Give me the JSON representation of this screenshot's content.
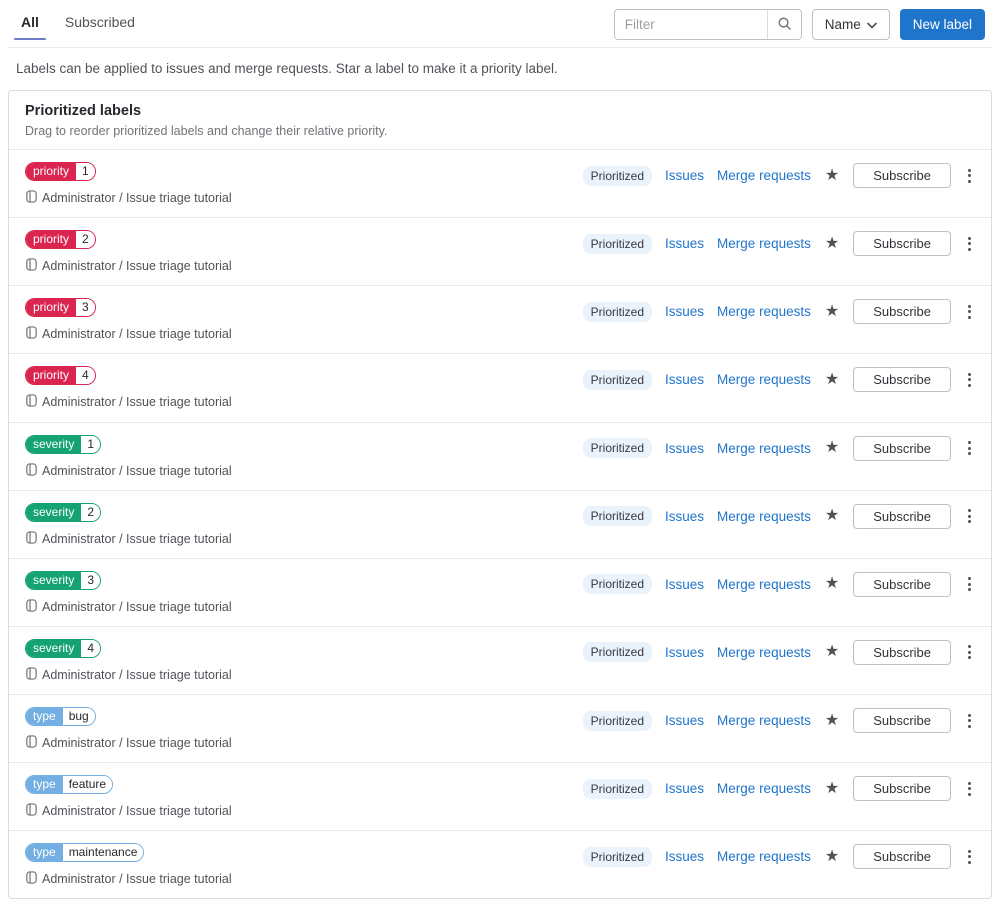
{
  "tabs": [
    {
      "label": "All",
      "active": true
    },
    {
      "label": "Subscribed",
      "active": false
    }
  ],
  "filter": {
    "placeholder": "Filter"
  },
  "sort_dropdown": {
    "label": "Name"
  },
  "new_label_button": "New label",
  "description": "Labels can be applied to issues and merge requests. Star a label to make it a priority label.",
  "card": {
    "title": "Prioritized labels",
    "subtitle": "Drag to reorder prioritized labels and change their relative priority."
  },
  "row_common": {
    "badge": "Prioritized",
    "issues_link": "Issues",
    "merge_requests_link": "Merge requests",
    "subscribe_button": "Subscribe",
    "star_icon": "star-icon",
    "kebab_icon": "kebab-menu-icon",
    "project_icon": "project-icon"
  },
  "colors": {
    "accent_blue": "#1f75cb",
    "tab_indicator": "#6e7bc4",
    "priority_red": "#d9254f",
    "severity_green": "#15a374",
    "type_blue": "#73afe3",
    "badge_bg": "#eaf2fb"
  },
  "labels": [
    {
      "scope": "priority",
      "value": "1",
      "color": "#d9254f",
      "project": "Administrator / Issue triage tutorial"
    },
    {
      "scope": "priority",
      "value": "2",
      "color": "#d9254f",
      "project": "Administrator / Issue triage tutorial"
    },
    {
      "scope": "priority",
      "value": "3",
      "color": "#d9254f",
      "project": "Administrator / Issue triage tutorial"
    },
    {
      "scope": "priority",
      "value": "4",
      "color": "#d9254f",
      "project": "Administrator / Issue triage tutorial"
    },
    {
      "scope": "severity",
      "value": "1",
      "color": "#15a374",
      "project": "Administrator / Issue triage tutorial"
    },
    {
      "scope": "severity",
      "value": "2",
      "color": "#15a374",
      "project": "Administrator / Issue triage tutorial"
    },
    {
      "scope": "severity",
      "value": "3",
      "color": "#15a374",
      "project": "Administrator / Issue triage tutorial"
    },
    {
      "scope": "severity",
      "value": "4",
      "color": "#15a374",
      "project": "Administrator / Issue triage tutorial"
    },
    {
      "scope": "type",
      "value": "bug",
      "color": "#73afe3",
      "project": "Administrator / Issue triage tutorial"
    },
    {
      "scope": "type",
      "value": "feature",
      "color": "#73afe3",
      "project": "Administrator / Issue triage tutorial"
    },
    {
      "scope": "type",
      "value": "maintenance",
      "color": "#73afe3",
      "project": "Administrator / Issue triage tutorial"
    }
  ]
}
